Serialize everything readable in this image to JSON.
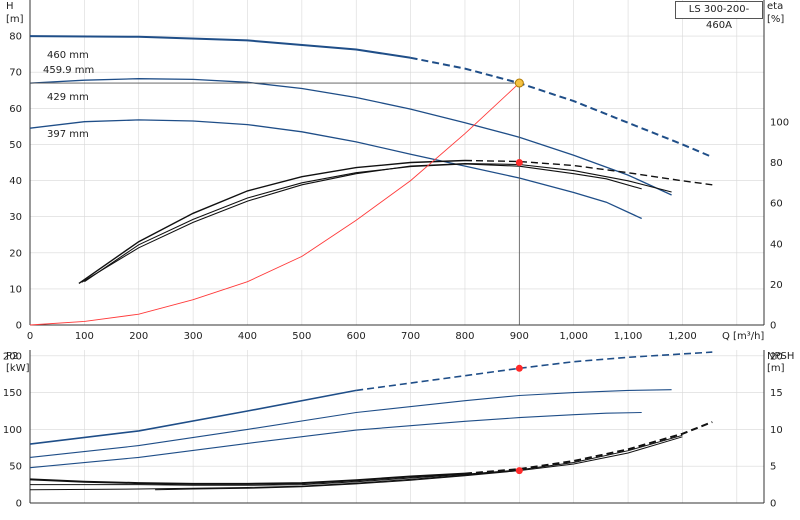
{
  "model_label": "LS 300-200-460A",
  "colors": {
    "head": "#1f4e88",
    "eff": "#111111",
    "system": "#ff3b3b",
    "op": "#ff2a2a",
    "op_head": "#f5c242"
  },
  "chart_data": [
    {
      "id": "top",
      "type": "line",
      "yleft_title": [
        "H",
        "[m]"
      ],
      "yright_title": [
        "eta",
        "[%]"
      ],
      "xlabel": "Q [m³/h]",
      "xlim": [
        0,
        1350
      ],
      "ylim": [
        0,
        90
      ],
      "yright_lim": [
        0,
        160
      ],
      "x_ticks": [
        "0",
        "100",
        "200",
        "300",
        "400",
        "500",
        "600",
        "700",
        "800",
        "900",
        "1,000",
        "1,100",
        "1,200"
      ],
      "x_tick_values": [
        0,
        100,
        200,
        300,
        400,
        500,
        600,
        700,
        800,
        900,
        1000,
        1100,
        1200
      ],
      "yleft_ticks": [
        0,
        10,
        20,
        30,
        40,
        50,
        60,
        70,
        80
      ],
      "yright_ticks": [
        0,
        20,
        40,
        60,
        80,
        100
      ],
      "diameter_labels": [
        "460 mm",
        "459.9 mm",
        "429 mm",
        "397 mm"
      ],
      "head_curves": [
        {
          "name": "460 mm",
          "dashed_from": 700,
          "points": [
            [
              0,
              80
            ],
            [
              200,
              79.8
            ],
            [
              400,
              78.8
            ],
            [
              600,
              76.3
            ],
            [
              700,
              74
            ],
            [
              800,
              71
            ],
            [
              900,
              67
            ],
            [
              1000,
              62
            ],
            [
              1100,
              56
            ],
            [
              1200,
              50
            ],
            [
              1255,
              46.5
            ]
          ]
        },
        {
          "name": "429 mm",
          "dashed_from": null,
          "points": [
            [
              0,
              67
            ],
            [
              100,
              67.8
            ],
            [
              200,
              68.2
            ],
            [
              300,
              68
            ],
            [
              400,
              67.2
            ],
            [
              500,
              65.5
            ],
            [
              600,
              63
            ],
            [
              700,
              59.8
            ],
            [
              800,
              56
            ],
            [
              900,
              52
            ],
            [
              1000,
              47
            ],
            [
              1100,
              41.5
            ],
            [
              1180,
              36
            ]
          ]
        },
        {
          "name": "397 mm",
          "dashed_from": null,
          "points": [
            [
              0,
              54.5
            ],
            [
              100,
              56.3
            ],
            [
              200,
              56.8
            ],
            [
              300,
              56.5
            ],
            [
              400,
              55.5
            ],
            [
              500,
              53.5
            ],
            [
              600,
              50.7
            ],
            [
              700,
              47.3
            ],
            [
              800,
              44
            ],
            [
              900,
              40.7
            ],
            [
              1000,
              36.7
            ],
            [
              1060,
              34
            ],
            [
              1125,
              29.5
            ]
          ]
        }
      ],
      "eff_curves": [
        {
          "name": "eff-460",
          "dashed_from": 850,
          "points": [
            [
              90,
              20.5
            ],
            [
              200,
              41
            ],
            [
              300,
              55
            ],
            [
              400,
              66
            ],
            [
              500,
              73
            ],
            [
              600,
              77.5
            ],
            [
              700,
              80
            ],
            [
              800,
              81
            ],
            [
              900,
              80.5
            ],
            [
              1000,
              78.5
            ],
            [
              1100,
              75
            ],
            [
              1200,
              71
            ],
            [
              1255,
              69
            ]
          ]
        },
        {
          "name": "eff-429",
          "dashed_from": null,
          "points": [
            [
              95,
              21
            ],
            [
              200,
              38
            ],
            [
              300,
              50.5
            ],
            [
              400,
              61
            ],
            [
              500,
              69
            ],
            [
              600,
              74.5
            ],
            [
              700,
              78.3
            ],
            [
              800,
              79.5
            ],
            [
              900,
              79
            ],
            [
              1000,
              76
            ],
            [
              1100,
              71
            ],
            [
              1180,
              65.5
            ]
          ]
        },
        {
          "name": "eff-397",
          "dashed_from": null,
          "points": [
            [
              100,
              21.3
            ],
            [
              200,
              39.5
            ],
            [
              300,
              52
            ],
            [
              400,
              62.5
            ],
            [
              500,
              70
            ],
            [
              600,
              75
            ],
            [
              700,
              78
            ],
            [
              800,
              79.3
            ],
            [
              900,
              78.2
            ],
            [
              1000,
              74.5
            ],
            [
              1060,
              72
            ],
            [
              1125,
              67
            ]
          ]
        }
      ],
      "system_curve": {
        "name": "system",
        "points": [
          [
            0,
            0
          ],
          [
            100,
            1
          ],
          [
            200,
            3
          ],
          [
            300,
            7
          ],
          [
            400,
            12
          ],
          [
            500,
            19
          ],
          [
            600,
            29
          ],
          [
            700,
            40
          ],
          [
            800,
            53
          ],
          [
            900,
            67
          ]
        ]
      },
      "operating_point": {
        "q": 900,
        "h": 67,
        "eta": 80
      }
    },
    {
      "id": "bottom",
      "type": "line",
      "yleft_title": [
        "P2",
        "[kW]"
      ],
      "yright_title": [
        "NPSH",
        "[m]"
      ],
      "xlim": [
        0,
        1350
      ],
      "ylim": [
        0,
        250
      ],
      "yright_lim": [
        0,
        25
      ],
      "yleft_ticks": [
        0,
        50,
        100,
        150,
        200
      ],
      "yright_ticks": [
        0,
        5,
        10,
        15,
        20
      ],
      "power_curves": [
        {
          "name": "P2-460",
          "dashed_from": 700,
          "points": [
            [
              0,
              80
            ],
            [
              200,
              98
            ],
            [
              400,
              125
            ],
            [
              600,
              153
            ],
            [
              800,
              173
            ],
            [
              900,
              183
            ],
            [
              1000,
              192
            ],
            [
              1100,
              198
            ],
            [
              1255,
              205
            ]
          ]
        },
        {
          "name": "P2-429",
          "dashed_from": null,
          "points": [
            [
              0,
              62
            ],
            [
              200,
              78
            ],
            [
              400,
              100
            ],
            [
              600,
              123
            ],
            [
              800,
              139
            ],
            [
              900,
              146
            ],
            [
              1000,
              150
            ],
            [
              1100,
              153
            ],
            [
              1180,
              154
            ]
          ]
        },
        {
          "name": "P2-397",
          "dashed_from": null,
          "points": [
            [
              0,
              48
            ],
            [
              200,
              62
            ],
            [
              400,
              81
            ],
            [
              600,
              99
            ],
            [
              800,
              111
            ],
            [
              900,
              116
            ],
            [
              1000,
              120
            ],
            [
              1060,
              122
            ],
            [
              1125,
              123
            ]
          ]
        }
      ],
      "npsh_curves": [
        {
          "name": "NPSH-a",
          "dashed_from": 850,
          "points": [
            [
              0,
              3.2
            ],
            [
              100,
              2.9
            ],
            [
              200,
              2.7
            ],
            [
              300,
              2.6
            ],
            [
              400,
              2.6
            ],
            [
              500,
              2.7
            ],
            [
              600,
              3.1
            ],
            [
              700,
              3.6
            ],
            [
              800,
              4.0
            ],
            [
              900,
              4.6
            ],
            [
              1000,
              5.7
            ],
            [
              1100,
              7.3
            ],
            [
              1200,
              9.4
            ],
            [
              1255,
              11
            ]
          ]
        },
        {
          "name": "NPSH-b",
          "dashed_from": null,
          "points": [
            [
              0,
              2.5
            ],
            [
              200,
              2.5
            ],
            [
              300,
              2.4
            ],
            [
              400,
              2.4
            ],
            [
              500,
              2.5
            ],
            [
              600,
              2.9
            ],
            [
              700,
              3.4
            ],
            [
              800,
              3.9
            ],
            [
              900,
              4.5
            ],
            [
              1000,
              5.5
            ],
            [
              1100,
              7.1
            ],
            [
              1200,
              9.2
            ]
          ]
        },
        {
          "name": "NPSH-c",
          "dashed_from": null,
          "points": [
            [
              0,
              1.8
            ],
            [
              200,
              1.9
            ],
            [
              300,
              2.0
            ],
            [
              400,
              2.1
            ],
            [
              500,
              2.3
            ],
            [
              600,
              2.7
            ],
            [
              700,
              3.2
            ],
            [
              800,
              3.8
            ],
            [
              900,
              4.4
            ],
            [
              1000,
              5.3
            ],
            [
              1100,
              6.8
            ],
            [
              1200,
              9.0
            ]
          ]
        },
        {
          "name": "NPSH-d",
          "dashed_from": null,
          "points": [
            [
              230,
              1.8
            ],
            [
              300,
              1.9
            ],
            [
              400,
              2.0
            ],
            [
              500,
              2.2
            ],
            [
              600,
              2.6
            ],
            [
              700,
              3.1
            ],
            [
              800,
              3.7
            ],
            [
              900,
              4.4
            ]
          ]
        }
      ],
      "operating_points": {
        "q": 900,
        "p2": 183,
        "npsh": 4.4
      }
    }
  ]
}
